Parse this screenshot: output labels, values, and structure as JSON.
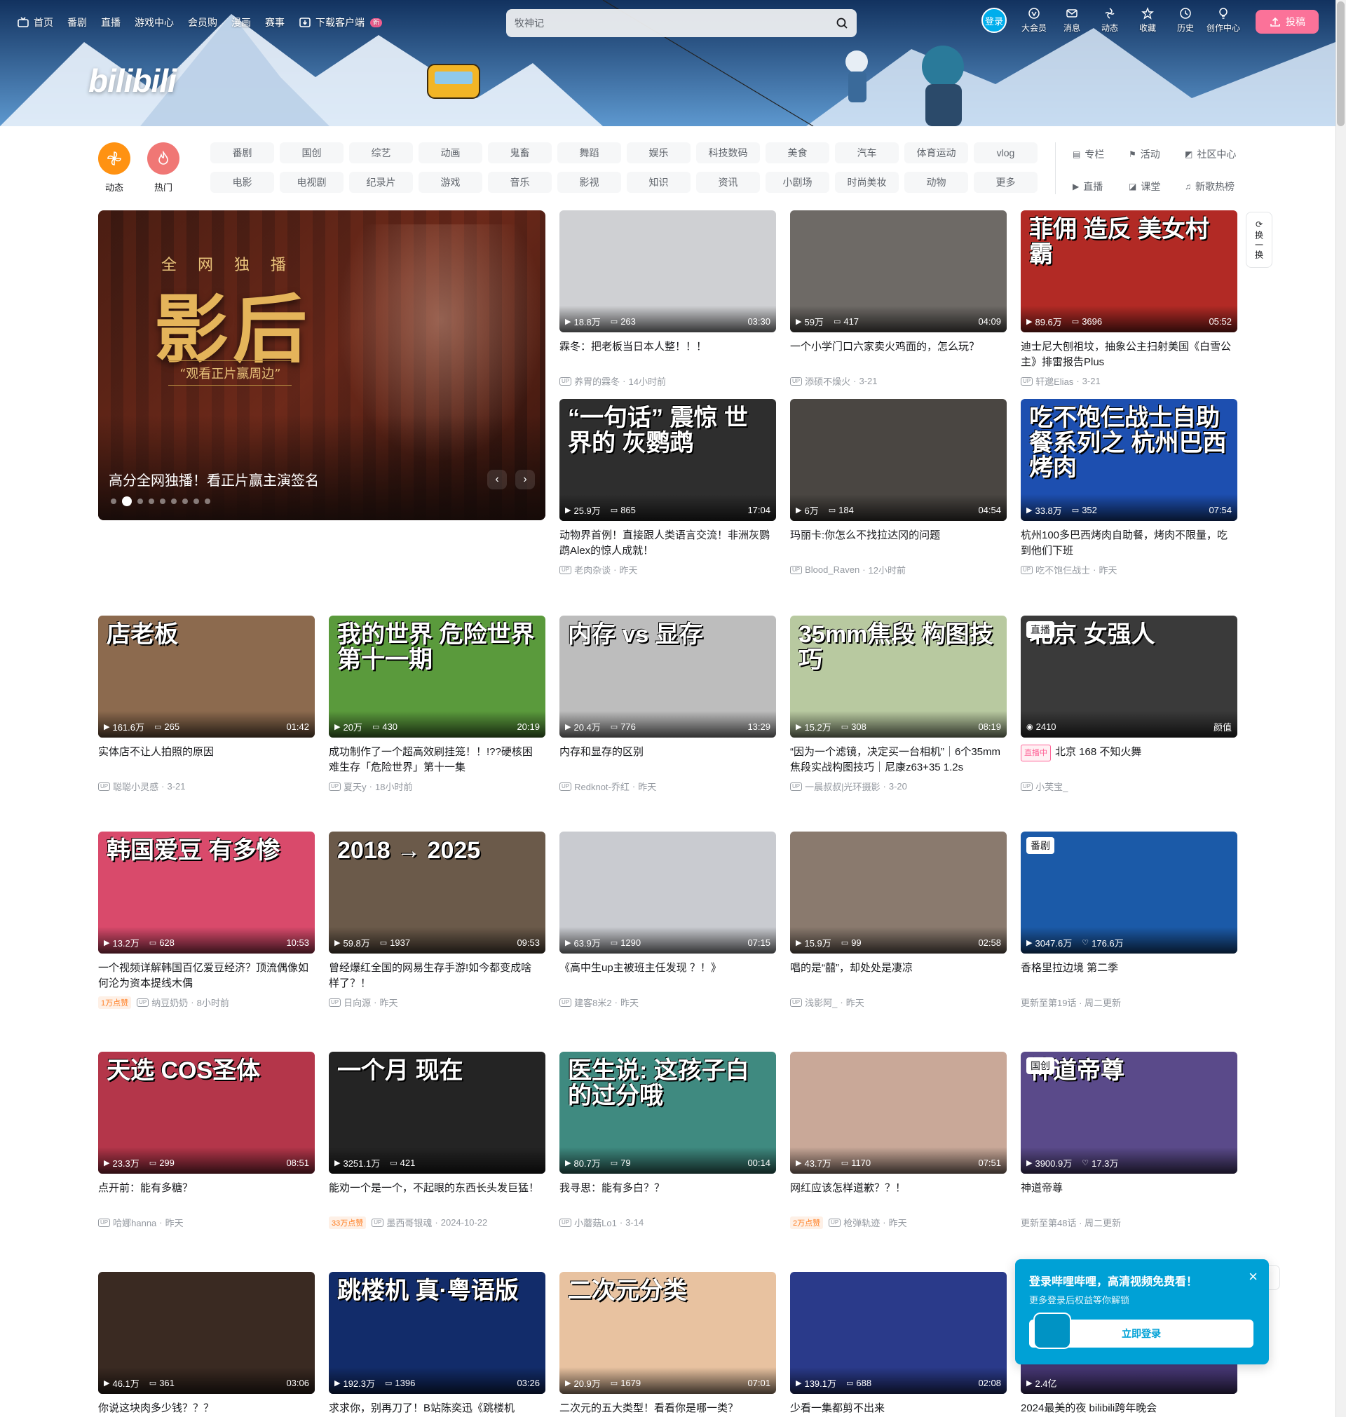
{
  "header": {
    "nav": [
      {
        "label": "首页",
        "icon": "tv-icon"
      },
      {
        "label": "番剧"
      },
      {
        "label": "直播"
      },
      {
        "label": "游戏中心"
      },
      {
        "label": "会员购"
      },
      {
        "label": "漫画"
      },
      {
        "label": "赛事"
      },
      {
        "label": "下载客户端",
        "badge": "新",
        "icon": "download-icon"
      }
    ],
    "search_placeholder": "牧神记",
    "login": "登录",
    "tools": [
      {
        "label": "大会员",
        "icon": "vip-icon"
      },
      {
        "label": "消息",
        "icon": "message-icon"
      },
      {
        "label": "动态",
        "icon": "feed-icon"
      },
      {
        "label": "收藏",
        "icon": "star-icon"
      },
      {
        "label": "历史",
        "icon": "clock-icon"
      },
      {
        "label": "创作中心",
        "icon": "bulb-icon"
      }
    ],
    "upload": "投稿",
    "logo": "bilibili",
    "accent": "#fb7299",
    "brand_blue": "#00aeec"
  },
  "channels": {
    "dynamic": "动态",
    "hot": "热门",
    "chips": [
      "番剧",
      "国创",
      "综艺",
      "动画",
      "鬼畜",
      "舞蹈",
      "娱乐",
      "科技数码",
      "美食",
      "汽车",
      "体育运动",
      "vlog",
      "电影",
      "电视剧",
      "纪录片",
      "游戏",
      "音乐",
      "影视",
      "知识",
      "资讯",
      "小剧场",
      "时尚美妆",
      "动物",
      "更多"
    ],
    "links": [
      {
        "label": "专栏",
        "icon": "article-icon"
      },
      {
        "label": "活动",
        "icon": "flag-icon"
      },
      {
        "label": "社区中心",
        "icon": "community-icon"
      },
      {
        "label": "直播",
        "icon": "live-icon"
      },
      {
        "label": "课堂",
        "icon": "class-icon"
      },
      {
        "label": "新歌热榜",
        "icon": "music-icon"
      }
    ]
  },
  "carousel": {
    "caption": "高分全网独播！看正片赢主演签名",
    "title_big": "影后",
    "title_top": "全网独播",
    "title_tag": "“观看正片赢周边”",
    "dot_count": 9,
    "active_dot": 1
  },
  "refresh": {
    "label": "换一换"
  },
  "cards": [
    {
      "title": "霖冬：把老板当日本人整！！！",
      "author": "养胃的霖冬",
      "time": "14小时前",
      "views": "18.8万",
      "danmaku": "263",
      "duration": "03:30",
      "bg": "#cfd0d3",
      "thumb_text": ""
    },
    {
      "title": "一个小学门口六家卖火鸡面的，怎么玩？",
      "author": "添硕不燥火",
      "time": "3-21",
      "views": "59万",
      "danmaku": "417",
      "duration": "04:09",
      "bg": "#6e6a66",
      "thumb_text": ""
    },
    {
      "title": "迪士尼大刨祖坟，抽象公主扫射美国《白雪公主》排雷报告Plus",
      "author": "轩邈Elias",
      "time": "3-21",
      "views": "89.6万",
      "danmaku": "3696",
      "duration": "05:52",
      "bg": "#b22a25",
      "thumb_text": "菲佣 造反 美女村霸"
    },
    {
      "title": "动物界首例！直接跟人类语言交流！非洲灰鹦鹉Alex的惊人成就！",
      "author": "老肉杂谈",
      "time": "昨天",
      "views": "25.9万",
      "danmaku": "865",
      "duration": "17:04",
      "bg": "#2e2e2e",
      "thumb_text": "“一句话” 震惊 世界的 灰鹦鹉"
    },
    {
      "title": "玛丽卡:你怎么不找拉达冈的问题",
      "author": "Blood_Raven",
      "time": "12小时前",
      "views": "6万",
      "danmaku": "184",
      "duration": "04:54",
      "bg": "#4a4642",
      "thumb_text": ""
    },
    {
      "title": "杭州100多巴西烤肉自助餐，烤肉不限量，吃到他们下班",
      "author": "吃不饱仨战士",
      "time": "昨天",
      "views": "33.8万",
      "danmaku": "352",
      "duration": "07:54",
      "bg": "#1d4fb0",
      "thumb_text": "吃不饱仨战士自助餐系列之 杭州巴西烤肉"
    },
    {
      "title": "实体店不让人拍照的原因",
      "author": "聪聪小灵感",
      "time": "3-21",
      "views": "161.6万",
      "danmaku": "265",
      "duration": "01:42",
      "bg": "#8c6a4e",
      "thumb_text": "店老板"
    },
    {
      "title": "成功制作了一个超高效刷挂笼！！!??硬核困难生存「危险世界」第十一集",
      "author": "夏天y",
      "time": "18小时前",
      "views": "20万",
      "danmaku": "430",
      "duration": "20:19",
      "bg": "#5a9a3c",
      "thumb_text": "我的世界 危险世界 第十一期"
    },
    {
      "title": "内存和显存的区别",
      "author": "Redknot-乔红",
      "time": "昨天",
      "views": "20.4万",
      "danmaku": "776",
      "duration": "13:29",
      "bg": "#bdbdbd",
      "thumb_text": "内存 vs 显存"
    },
    {
      "title": "“因为一个滤镜，决定买一台相机”｜6个35mm焦段实战构图技巧｜尼康z63+35 1.2s",
      "author": "一晨叔叔|光环摄影",
      "time": "3-20",
      "views": "15.2万",
      "danmaku": "308",
      "duration": "08:19",
      "bg": "#b8c9a0",
      "thumb_text": "35mm焦段 构图技巧"
    },
    {
      "title": "北京 168 不知火舞",
      "author": "小芙宝_",
      "time": "",
      "views": "2410",
      "danmaku": "",
      "duration": "颜值",
      "bg": "#3a3a3a",
      "thumb_text": "北京 女强人",
      "badge": "直播",
      "live": "直播中"
    },
    {
      "title": "一个视频详解韩国百亿爱豆经济？顶流偶像如何沦为资本提线木偶",
      "author": "纳豆奶奶",
      "time": "8小时前",
      "views": "13.2万",
      "danmaku": "628",
      "duration": "10:53",
      "bg": "#d94a6b",
      "thumb_text": "韩国爱豆 有多惨",
      "hot": "1万点赞"
    },
    {
      "title": "曾经爆红全国的网易生存手游!如今都变成啥样了？！",
      "author": "日向源",
      "time": "昨天",
      "views": "59.8万",
      "danmaku": "1937",
      "duration": "09:53",
      "bg": "#6b5a4a",
      "thumb_text": "2018 → 2025"
    },
    {
      "title": "《高中生up主被班主任发现 ？！》",
      "author": "建客8米2",
      "time": "昨天",
      "views": "63.9万",
      "danmaku": "1290",
      "duration": "07:15",
      "bg": "#c9cbd0",
      "thumb_text": ""
    },
    {
      "title": "唱的是“囍”，却处处是凄凉",
      "author": "浅影阿_",
      "time": "昨天",
      "views": "15.9万",
      "danmaku": "99",
      "duration": "02:58",
      "bg": "#8a7a6e",
      "thumb_text": ""
    },
    {
      "title": "香格里拉边境 第二季",
      "author": "",
      "time": "更新至第19话 · 周二更新",
      "views": "3047.6万",
      "danmaku": "176.6万",
      "duration": "",
      "bg": "#1b5aa8",
      "thumb_text": "",
      "badge": "番剧",
      "likes": true
    },
    {
      "title": "点开前：能有多糖？",
      "author": "哈娜hanna",
      "time": "昨天",
      "views": "23.3万",
      "danmaku": "299",
      "duration": "08:51",
      "bg": "#b4364a",
      "thumb_text": "天选 COS圣体"
    },
    {
      "title": "能劝一个是一个，不起眼的东西长头发巨猛！",
      "author": "墨西哥银魂",
      "time": "2024-10-22",
      "views": "3251.1万",
      "danmaku": "421",
      "duration": "",
      "bg": "#242424",
      "thumb_text": "一个月 现在",
      "hot": "33万点赞"
    },
    {
      "title": "我寻思：能有多白？？",
      "author": "小蘑菇Lo1",
      "time": "3-14",
      "views": "80.7万",
      "danmaku": "79",
      "duration": "00:14",
      "bg": "#3f8a80",
      "thumb_text": "医生说: 这孩子白的过分哦"
    },
    {
      "title": "网红应该怎样道歉？？！",
      "author": "枪弹轨迹",
      "time": "昨天",
      "views": "43.7万",
      "danmaku": "1170",
      "duration": "07:51",
      "bg": "#c9a898",
      "thumb_text": "",
      "hot": "2万点赞"
    },
    {
      "title": "神道帝尊",
      "author": "",
      "time": "更新至第48话 · 周二更新",
      "views": "3900.9万",
      "danmaku": "17.3万",
      "duration": "",
      "bg": "#5a4a8a",
      "thumb_text": "神道帝尊",
      "badge": "国创",
      "likes": true
    },
    {
      "title": "你说这块肉多少钱？？？",
      "author": "",
      "time": "",
      "views": "46.1万",
      "danmaku": "361",
      "duration": "03:06",
      "bg": "#3a2a22",
      "thumb_text": ""
    },
    {
      "title": "求求你，别再刀了！B站陈奕迅《跳楼机",
      "author": "",
      "time": "",
      "views": "192.3万",
      "danmaku": "1396",
      "duration": "03:26",
      "bg": "#122c6a",
      "thumb_text": "跳楼机 真·粤语版"
    },
    {
      "title": "二次元的五大类型！看看你是哪一类？",
      "author": "",
      "time": "",
      "views": "20.9万",
      "danmaku": "1679",
      "duration": "07:01",
      "bg": "#e8c2a0",
      "thumb_text": "二次元分类"
    },
    {
      "title": "少看一集都剪不出来",
      "author": "",
      "time": "",
      "views": "139.1万",
      "danmaku": "688",
      "duration": "02:08",
      "bg": "#2a3a8a",
      "thumb_text": ""
    },
    {
      "title": "2024最美的夜 bilibili跨年晚会",
      "author": "",
      "time": "",
      "views": "2.4亿",
      "danmaku": "",
      "duration": "",
      "bg": "#4a3a7a",
      "thumb_text": ""
    }
  ],
  "login_popup": {
    "title": "登录哔哩哔哩，高清视频免费看！",
    "desc": "更多登录后权益等你解锁",
    "button": "立即登录"
  }
}
